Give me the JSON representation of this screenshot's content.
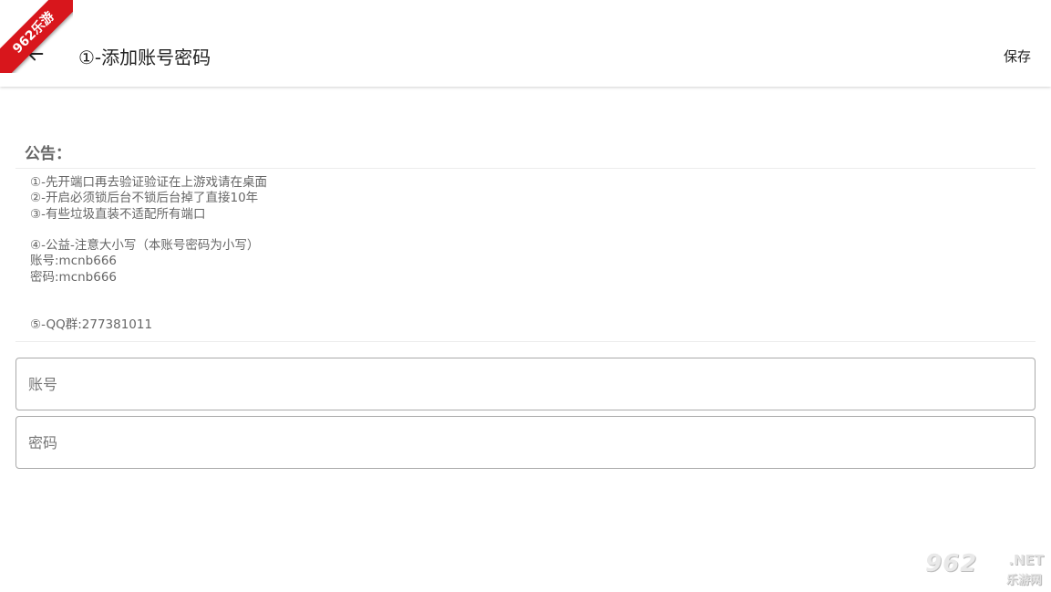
{
  "appbar": {
    "title": "①-添加账号密码",
    "save_label": "保存",
    "back_icon": "arrow-left-icon"
  },
  "notice": {
    "title": "公告：",
    "lines": [
      "①-先开端口再去验证验证在上游戏请在桌面",
      "②-开启必须锁后台不锁后台掉了直接10年",
      "③-有些垃圾直装不适配所有端口",
      "",
      "④-公益-注意大小写（本账号密码为小写）",
      "账号:mcnb666",
      "密码:mcnb666",
      "",
      "",
      "⑤-QQ群:277381011"
    ]
  },
  "form": {
    "account_placeholder": "账号",
    "password_placeholder": "密码",
    "account_value": "",
    "password_value": ""
  },
  "watermarks": {
    "ribbon_text": "962乐游",
    "logo_main": "962",
    "logo_net": ".NET",
    "logo_sub": "乐游网"
  },
  "colors": {
    "ribbon": "#d8161c",
    "text_primary": "#222222",
    "text_secondary": "#666666",
    "input_border": "#aaaaaa"
  }
}
